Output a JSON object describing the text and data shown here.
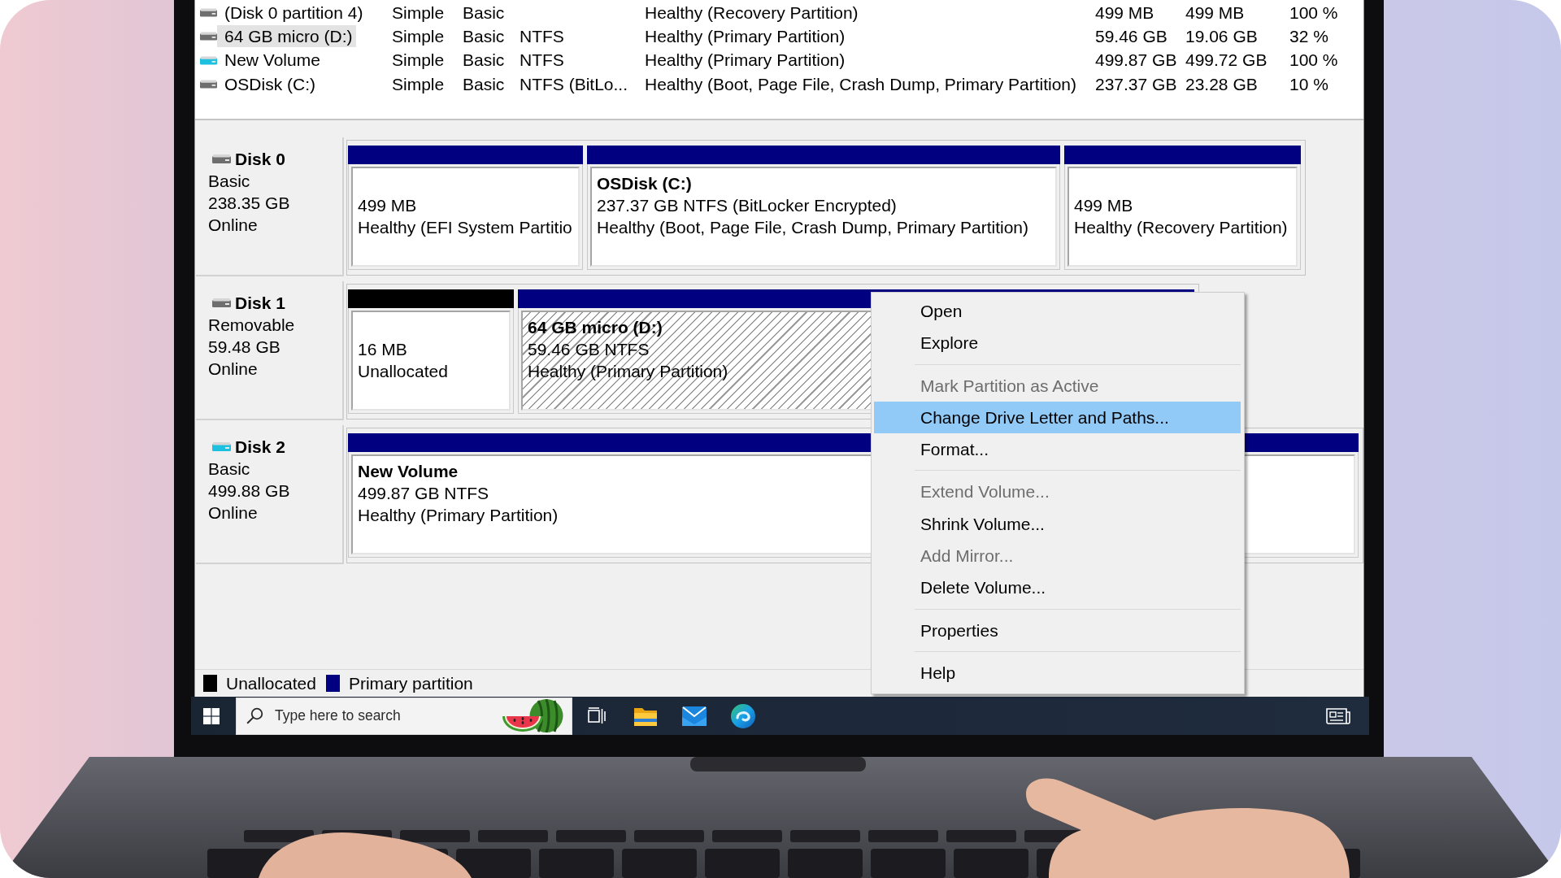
{
  "volume_list": {
    "rows": [
      {
        "column_1": "(Disk 0 partition 4)",
        "column_2": "Simple",
        "column_3": "Basic",
        "column_5": "Healthy (Recovery Partition)",
        "column_6": "499 MB",
        "column_7": "499 MB",
        "column_8": "100 %",
        "color": "#6e6e6e",
        "selected": false
      },
      {
        "column_1": "64 GB micro (D:)",
        "column_2": "Simple",
        "column_3": "Basic",
        "column_4": "NTFS",
        "column_5": "Healthy (Primary Partition)",
        "column_6": "59.46 GB",
        "column_7": "19.06 GB",
        "column_8": "32 %",
        "color": "#6e6e6e",
        "selected": true
      },
      {
        "column_1": "New Volume",
        "column_2": "Simple",
        "column_3": "Basic",
        "column_4": "NTFS",
        "column_5": "Healthy (Primary Partition)",
        "column_6": "499.87 GB",
        "column_7": "499.72 GB",
        "column_8": "100 %",
        "color": "#1ec0e0",
        "selected": false
      },
      {
        "column_1": "OSDisk (C:)",
        "column_2": "Simple",
        "column_3": "Basic",
        "column_4": "NTFS (BitLo...",
        "column_5": "Healthy (Boot, Page File, Crash Dump, Primary Partition)",
        "column_6": "237.37 GB",
        "column_7": "23.28 GB",
        "column_8": "10 %",
        "color": "#6e6e6e",
        "selected": false
      }
    ]
  },
  "disks": [
    {
      "name": "Disk 0",
      "type": "Basic",
      "size": "238.35 GB",
      "status": "Online",
      "color": "#6e6e6e",
      "partitions": [
        {
          "kind": "primary",
          "size": "499 MB",
          "status": "Healthy (EFI System Partitio",
          "selected": false
        },
        {
          "kind": "primary",
          "label": "OSDisk (C:)",
          "size": "237.37 GB NTFS (BitLocker Encrypted)",
          "status": "Healthy (Boot, Page File, Crash Dump, Primary Partition)",
          "selected": false
        },
        {
          "kind": "primary",
          "size": "499 MB",
          "status": "Healthy (Recovery Partition)",
          "selected": false
        }
      ]
    },
    {
      "name": "Disk 1",
      "type": "Removable",
      "size": "59.48 GB",
      "status": "Online",
      "color": "#6e6e6e",
      "partitions": [
        {
          "kind": "unallocated",
          "size": "16 MB",
          "status": "Unallocated",
          "selected": false
        },
        {
          "kind": "primary",
          "label": "64 GB micro (D:)",
          "size": "59.46 GB NTFS",
          "status": "Healthy (Primary Partition)",
          "selected": true
        }
      ]
    },
    {
      "name": "Disk 2",
      "type": "Basic",
      "size": "499.88 GB",
      "status": "Online",
      "color": "#1ec0e0",
      "partitions": [
        {
          "kind": "primary",
          "label": "New Volume",
          "size": "499.87 GB NTFS",
          "status": "Healthy (Primary Partition)",
          "selected": false
        }
      ]
    }
  ],
  "legend": [
    {
      "label": "Unallocated",
      "color": "#000000"
    },
    {
      "label": "Primary partition",
      "color": "#000080"
    }
  ],
  "context_menu": {
    "groups": [
      {
        "items": [
          {
            "label": "Open",
            "disabled": false,
            "selected": false
          },
          {
            "label": "Explore",
            "disabled": false,
            "selected": false
          }
        ]
      },
      {
        "items": [
          {
            "label": "Mark Partition as Active",
            "disabled": true,
            "selected": false
          },
          {
            "label": "Change Drive Letter and Paths...",
            "disabled": false,
            "selected": true
          },
          {
            "label": "Format...",
            "disabled": false,
            "selected": false
          }
        ]
      },
      {
        "items": [
          {
            "label": "Extend Volume...",
            "disabled": true,
            "selected": false
          },
          {
            "label": "Shrink Volume...",
            "disabled": false,
            "selected": false
          },
          {
            "label": "Add Mirror...",
            "disabled": true,
            "selected": false
          },
          {
            "label": "Delete Volume...",
            "disabled": false,
            "selected": false
          }
        ]
      },
      {
        "items": [
          {
            "label": "Properties",
            "disabled": false,
            "selected": false
          }
        ]
      },
      {
        "items": [
          {
            "label": "Help",
            "disabled": false,
            "selected": false
          }
        ]
      }
    ]
  },
  "taskbar": {
    "search": {
      "placeholder": "Type here to search"
    }
  }
}
